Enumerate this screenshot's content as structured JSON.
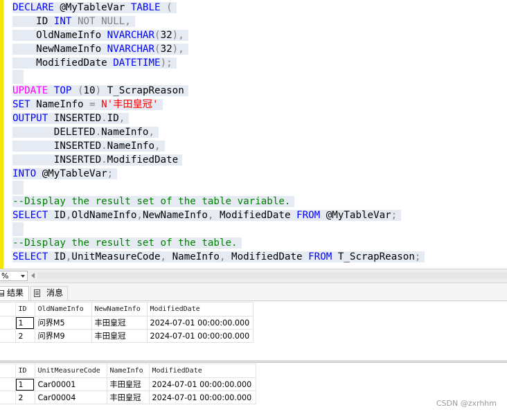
{
  "editor": {
    "lines": [
      [
        {
          "t": "DECLARE",
          "c": "kw"
        },
        {
          "t": " @MyTableVar ",
          "c": "id"
        },
        {
          "t": "TABLE",
          "c": "kw"
        },
        {
          "t": " (",
          "c": "op"
        }
      ],
      [
        {
          "t": "    ID ",
          "c": "id"
        },
        {
          "t": "INT",
          "c": "kw"
        },
        {
          "t": " NOT NULL,",
          "c": "op"
        }
      ],
      [
        {
          "t": "    OldNameInfo ",
          "c": "id"
        },
        {
          "t": "NVARCHAR",
          "c": "kw"
        },
        {
          "t": "(",
          "c": "op"
        },
        {
          "t": "32",
          "c": "id"
        },
        {
          "t": "),",
          "c": "op"
        }
      ],
      [
        {
          "t": "    NewNameInfo ",
          "c": "id"
        },
        {
          "t": "NVARCHAR",
          "c": "kw"
        },
        {
          "t": "(",
          "c": "op"
        },
        {
          "t": "32",
          "c": "id"
        },
        {
          "t": "),",
          "c": "op"
        }
      ],
      [
        {
          "t": "    ModifiedDate ",
          "c": "id"
        },
        {
          "t": "DATETIME",
          "c": "kw"
        },
        {
          "t": ");",
          "c": "op"
        }
      ],
      [],
      [
        {
          "t": "UPDATE",
          "c": "fn"
        },
        {
          "t": " ",
          "c": "id"
        },
        {
          "t": "TOP",
          "c": "kw"
        },
        {
          "t": " (",
          "c": "op"
        },
        {
          "t": "10",
          "c": "id"
        },
        {
          "t": ")",
          "c": "op"
        },
        {
          "t": " T_ScrapReason",
          "c": "id"
        }
      ],
      [
        {
          "t": "SET",
          "c": "kw"
        },
        {
          "t": " NameInfo ",
          "c": "id"
        },
        {
          "t": "=",
          "c": "op"
        },
        {
          "t": " N'丰田皇冠'",
          "c": "str"
        }
      ],
      [
        {
          "t": "OUTPUT",
          "c": "kw"
        },
        {
          "t": " INSERTED",
          "c": "id"
        },
        {
          "t": ".",
          "c": "op"
        },
        {
          "t": "ID",
          "c": "id"
        },
        {
          "t": ",",
          "c": "op"
        }
      ],
      [
        {
          "t": "       DELETED",
          "c": "id"
        },
        {
          "t": ".",
          "c": "op"
        },
        {
          "t": "NameInfo",
          "c": "id"
        },
        {
          "t": ",",
          "c": "op"
        }
      ],
      [
        {
          "t": "       INSERTED",
          "c": "id"
        },
        {
          "t": ".",
          "c": "op"
        },
        {
          "t": "NameInfo",
          "c": "id"
        },
        {
          "t": ",",
          "c": "op"
        }
      ],
      [
        {
          "t": "       INSERTED",
          "c": "id"
        },
        {
          "t": ".",
          "c": "op"
        },
        {
          "t": "ModifiedDate",
          "c": "id"
        }
      ],
      [
        {
          "t": "INTO",
          "c": "kw"
        },
        {
          "t": " @MyTableVar",
          "c": "id"
        },
        {
          "t": ";",
          "c": "op"
        }
      ],
      [],
      [
        {
          "t": "--Display the result set of the table variable.",
          "c": "cm"
        }
      ],
      [
        {
          "t": "SELECT",
          "c": "kw"
        },
        {
          "t": " ID",
          "c": "id"
        },
        {
          "t": ",",
          "c": "op"
        },
        {
          "t": "OldNameInfo",
          "c": "id"
        },
        {
          "t": ",",
          "c": "op"
        },
        {
          "t": "NewNameInfo",
          "c": "id"
        },
        {
          "t": ",",
          "c": "op"
        },
        {
          "t": " ModifiedDate ",
          "c": "id"
        },
        {
          "t": "FROM",
          "c": "kw"
        },
        {
          "t": " @MyTableVar",
          "c": "id"
        },
        {
          "t": ";",
          "c": "op"
        }
      ],
      [],
      [
        {
          "t": "--Display the result set of the table.",
          "c": "cm"
        }
      ],
      [
        {
          "t": "SELECT",
          "c": "kw"
        },
        {
          "t": " ID",
          "c": "id"
        },
        {
          "t": ",",
          "c": "op"
        },
        {
          "t": "UnitMeasureCode",
          "c": "id"
        },
        {
          "t": ",",
          "c": "op"
        },
        {
          "t": " NameInfo",
          "c": "id"
        },
        {
          "t": ",",
          "c": "op"
        },
        {
          "t": " ModifiedDate ",
          "c": "id"
        },
        {
          "t": "FROM",
          "c": "kw"
        },
        {
          "t": " T_ScrapReason",
          "c": "id"
        },
        {
          "t": ";",
          "c": "op"
        }
      ]
    ]
  },
  "zoom": {
    "value": "%"
  },
  "tabs": {
    "results_label": "结果",
    "messages_label": "消息"
  },
  "grid1": {
    "columns": [
      "ID",
      "OldNameInfo",
      "NewNameInfo",
      "ModifiedDate"
    ],
    "rows": [
      [
        "1",
        "问界M5",
        "丰田皇冠",
        "2024-07-01 00:00:00.000"
      ],
      [
        "2",
        "问界M9",
        "丰田皇冠",
        "2024-07-01 00:00:00.000"
      ]
    ]
  },
  "grid2": {
    "columns": [
      "ID",
      "UnitMeasureCode",
      "NameInfo",
      "ModifiedDate"
    ],
    "rows": [
      [
        "1",
        "Car00001",
        "丰田皇冠",
        "2024-07-01 00:00:00.000"
      ],
      [
        "2",
        "Car00004",
        "丰田皇冠",
        "2024-07-01 00:00:00.000"
      ]
    ]
  },
  "watermark": "CSDN @zxrhhm"
}
